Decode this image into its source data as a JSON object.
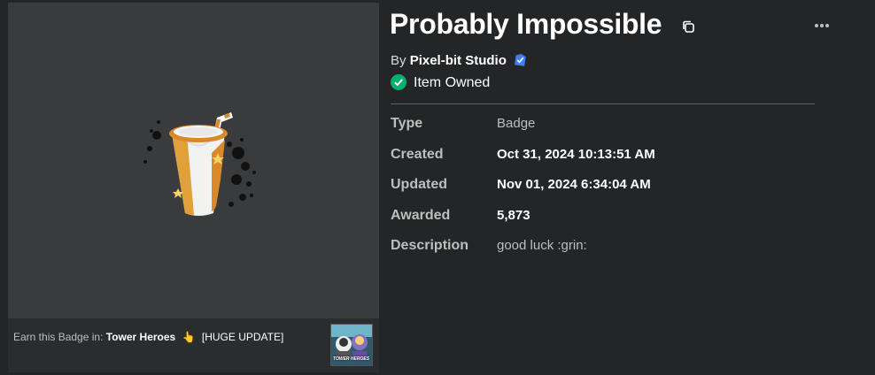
{
  "badge": {
    "title": "Probably Impossible",
    "creator_prefix": "By",
    "creator_name": "Pixel-bit Studio",
    "owned_label": "Item Owned"
  },
  "details": [
    {
      "label": "Type",
      "value": "Badge"
    },
    {
      "label": "Created",
      "value": "Oct 31, 2024 10:13:51 AM"
    },
    {
      "label": "Updated",
      "value": "Nov 01, 2024 6:34:04 AM"
    },
    {
      "label": "Awarded",
      "value": "5,873"
    },
    {
      "label": "Description",
      "value": "good luck :grin:"
    }
  ],
  "earn": {
    "prefix": "Earn this Badge in:",
    "game_name": "Tower Heroes",
    "hand_glyph": "👆",
    "update_tag": "[HUGE UPDATE]",
    "thumbnail_logo": "TOWER HEROES"
  },
  "icons": {
    "copy": "copy-icon",
    "more": "more-options-icon",
    "verified": "verified-badge-icon",
    "owned": "check-circle-icon"
  },
  "colors": {
    "background": "#232527",
    "panel": "#393b3d",
    "verified_blue": "#3d7df5",
    "owned_green": "#00b06f"
  }
}
